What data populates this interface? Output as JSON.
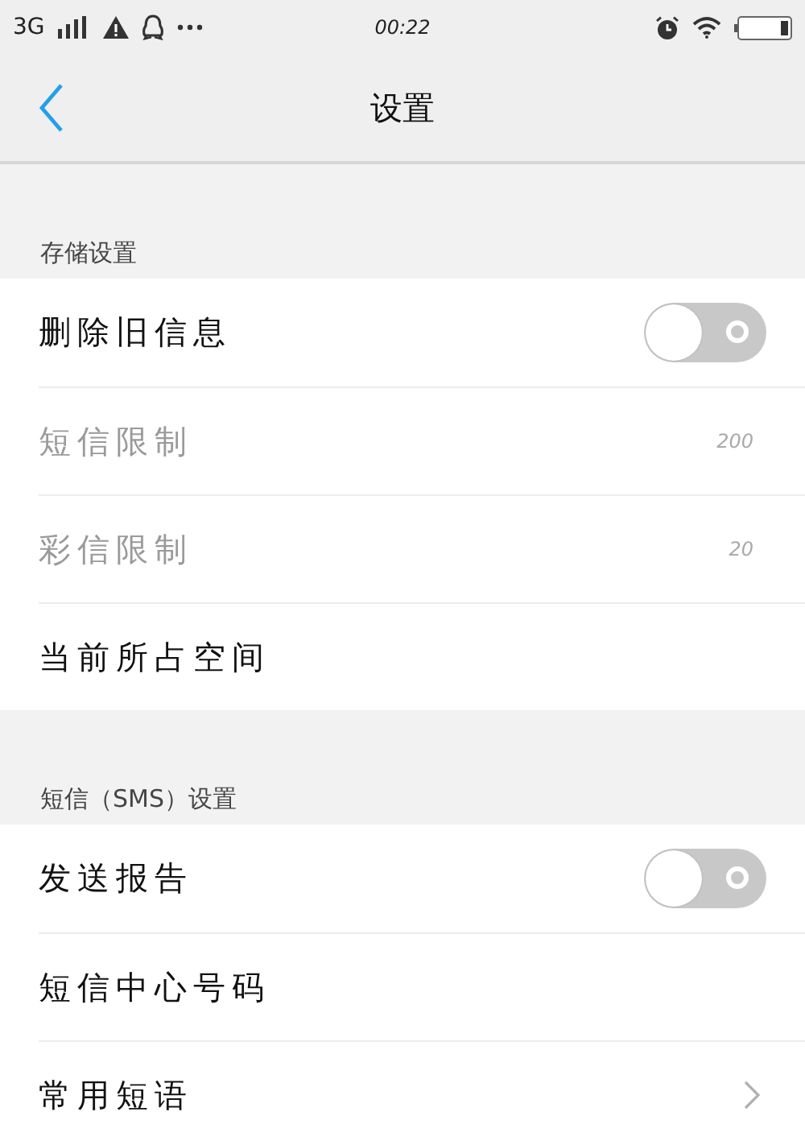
{
  "status_bar": {
    "network": "3G",
    "time": "00:22"
  },
  "nav": {
    "title": "设置"
  },
  "sections": [
    {
      "title": "存储设置",
      "items": [
        {
          "kind": "toggle",
          "label": "删除旧信息",
          "disabled": false,
          "on": false
        },
        {
          "kind": "value",
          "label": "短信限制",
          "disabled": true,
          "value": "200"
        },
        {
          "kind": "value",
          "label": "彩信限制",
          "disabled": true,
          "value": "20"
        },
        {
          "kind": "plain",
          "label": "当前所占空间",
          "disabled": false
        }
      ]
    },
    {
      "title": "短信（SMS）设置",
      "items": [
        {
          "kind": "toggle",
          "label": "发送报告",
          "disabled": false,
          "on": false
        },
        {
          "kind": "plain",
          "label": "短信中心号码",
          "disabled": false
        },
        {
          "kind": "chevron",
          "label": "常用短语",
          "disabled": false
        }
      ]
    }
  ]
}
